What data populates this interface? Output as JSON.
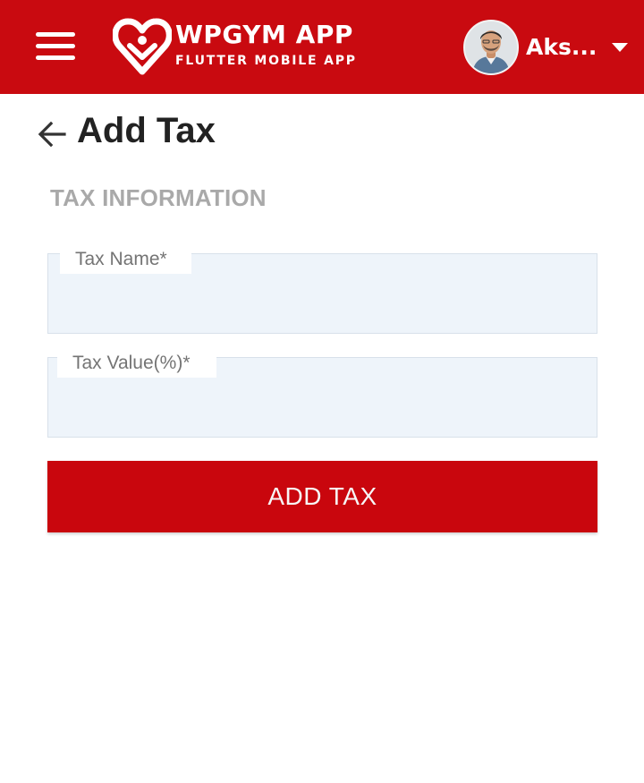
{
  "header": {
    "brand_name": "WPGYM APP",
    "brand_tagline": "FLUTTER MOBILE APP",
    "menu_icon": "hamburger-menu-icon",
    "logo_icon": "heart-gym-logo-icon",
    "user": {
      "name": "Aks...",
      "avatar_icon": "user-avatar",
      "dropdown_icon": "caret-down-icon"
    }
  },
  "page": {
    "title": "Add Tax",
    "back_icon": "arrow-left-icon"
  },
  "form": {
    "section_title": "TAX INFORMATION",
    "fields": [
      {
        "label": "Tax Name*",
        "value": "",
        "placeholder": ""
      },
      {
        "label": "Tax Value(%)*",
        "value": "",
        "placeholder": ""
      }
    ],
    "submit_label": "ADD TAX"
  },
  "colors": {
    "brand_red": "#c90a10",
    "field_background": "#eef4fa",
    "section_title_gray": "#a9a9a9",
    "label_gray": "#747474"
  }
}
